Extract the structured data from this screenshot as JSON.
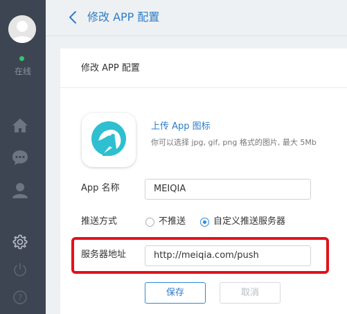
{
  "sidebar": {
    "status": "在线",
    "status_color": "#35c46a",
    "nav_icons": [
      "home-icon",
      "chat-icon",
      "user-icon",
      "settings-icon",
      "power-icon",
      "help-icon"
    ]
  },
  "header": {
    "back_icon": "chevron-left-icon",
    "title": "修改 APP 配置"
  },
  "card": {
    "title": "修改 APP 配置",
    "upload": {
      "link": "上传 App 图标",
      "hint": "你可以选择 jpg, gif, png 格式的图片, 最大 5Mb"
    },
    "app_name": {
      "label": "App 名称",
      "value": "MEIQIA"
    },
    "push": {
      "label": "推送方式",
      "options": [
        {
          "label": "不推送",
          "checked": false
        },
        {
          "label": "自定义推送服务器",
          "checked": true
        }
      ]
    },
    "server": {
      "label": "服务器地址",
      "value": "http://meiqia.com/push"
    },
    "buttons": {
      "save": "保存",
      "cancel": "取消"
    }
  },
  "colors": {
    "accent": "#2b7cc8",
    "sidebar_bg": "#3d4552",
    "highlight": "#e3111a",
    "app_icon": "#2ebfd0"
  }
}
